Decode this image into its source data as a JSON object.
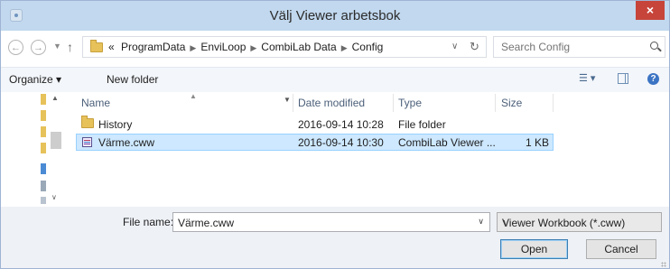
{
  "window": {
    "title": "Välj Viewer arbetsbok",
    "close_glyph": "×"
  },
  "address": {
    "segments": [
      "ProgramData",
      "EnviLoop",
      "CombiLab Data",
      "Config"
    ],
    "overflow": "«"
  },
  "search": {
    "placeholder": "Search Config"
  },
  "toolbar": {
    "organize_label": "Organize ▾",
    "new_folder_label": "New folder"
  },
  "columns": {
    "name": "Name",
    "date_modified": "Date modified",
    "type": "Type",
    "size": "Size"
  },
  "files": [
    {
      "name": "History",
      "date": "2016-09-14 10:28",
      "type": "File folder",
      "size": "",
      "icon": "folder-icon",
      "selected": false
    },
    {
      "name": "Värme.cww",
      "date": "2016-09-14 10:30",
      "type": "CombiLab Viewer ...",
      "size": "1 KB",
      "icon": "combilab-file-icon",
      "selected": true
    }
  ],
  "bottom": {
    "file_name_label": "File name:",
    "file_name_value": "Värme.cww",
    "file_type_selected": "Viewer Workbook (*.cww)",
    "open_label": "Open",
    "cancel_label": "Cancel"
  },
  "colors": {
    "titlebar": "#c1d8ee",
    "close": "#c7443a",
    "selection": "#cde8ff",
    "folder": "#e7c25b"
  }
}
